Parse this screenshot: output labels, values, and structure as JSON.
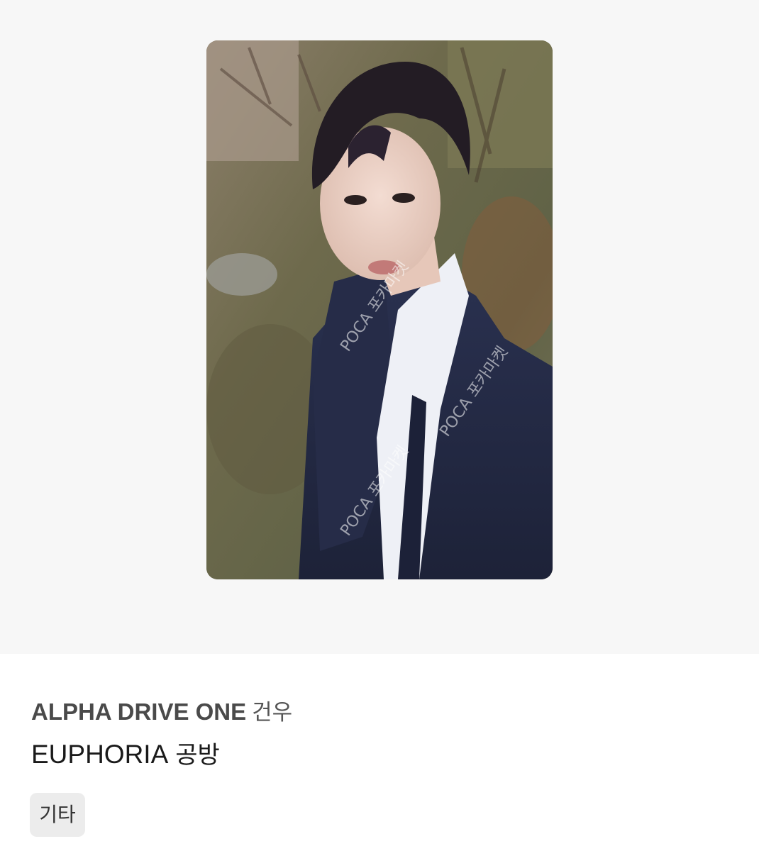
{
  "product": {
    "group": "ALPHA DRIVE ONE",
    "member": "건우",
    "album": "EUPHORIA",
    "album_type": "공방",
    "tag": "기타",
    "watermark": "POCA 포카마켓"
  },
  "colors": {
    "image_background": "#f7f7f7",
    "tag_background": "#ececec",
    "title_text": "#4a4a4a",
    "album_text": "#1a1a1a"
  }
}
